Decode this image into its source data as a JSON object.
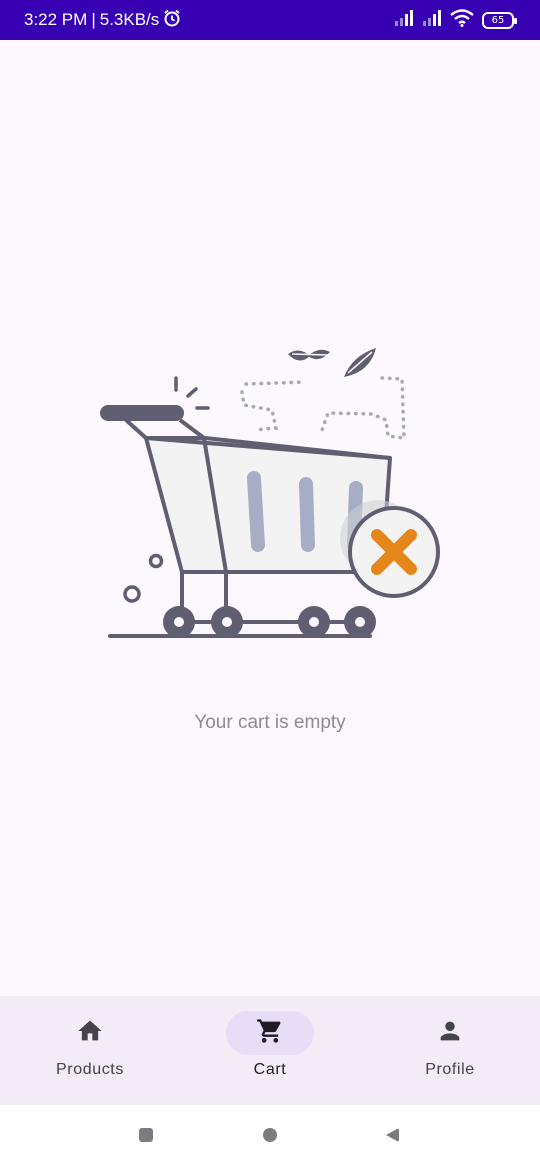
{
  "status_bar": {
    "time": "3:22 PM",
    "separator": "|",
    "net_speed": "5.3KB/s",
    "battery": "65",
    "icons": [
      "alarm-icon",
      "signal-icon",
      "signal-icon",
      "wifi-icon",
      "battery-icon"
    ]
  },
  "cart": {
    "empty_message": "Your cart is empty",
    "illustration_icon": "empty-cart-illustration"
  },
  "bottom_nav": {
    "items": [
      {
        "label": "Products",
        "icon": "home-icon",
        "active": false
      },
      {
        "label": "Cart",
        "icon": "cart-icon",
        "active": true
      },
      {
        "label": "Profile",
        "icon": "person-icon",
        "active": false
      }
    ]
  },
  "system_nav": {
    "buttons": [
      "recents-button",
      "home-button",
      "back-button"
    ]
  },
  "colors": {
    "status_bar": "#3700b3",
    "background": "#fdf7fe",
    "nav_background": "#f3ecf7",
    "active_pill": "#e8ddf6",
    "accent_orange": "#e5861a",
    "cart_stroke": "#5f5f71"
  }
}
